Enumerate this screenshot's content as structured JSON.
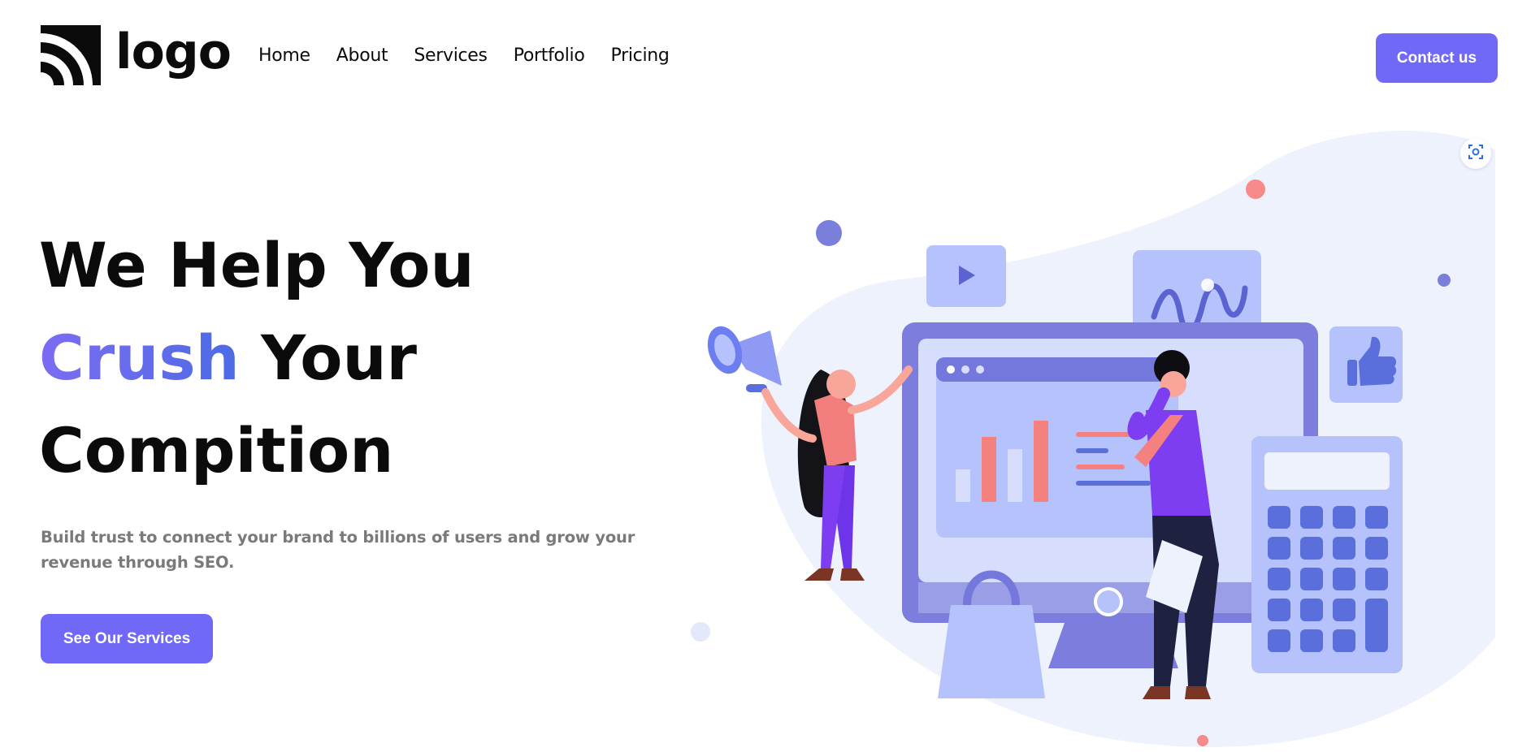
{
  "header": {
    "logo_text": "logo",
    "nav": [
      "Home",
      "About",
      "Services",
      "Portfolio",
      "Pricing"
    ],
    "contact_label": "Contact us"
  },
  "hero": {
    "title_line1": "We Help You",
    "title_accent": "Crush",
    "title_line2_rest": "Your",
    "title_line3": "Compition",
    "subtitle": "Build trust to connect your brand to billions of users and grow your revenue through SEO.",
    "cta_label": "See Our Services"
  },
  "icons": {
    "logo_mark": "wifi-arcs-logo-icon",
    "lens": "image-search-lens-icon",
    "play": "play-icon",
    "thumbs_up": "thumbs-up-icon",
    "megaphone": "megaphone-icon"
  },
  "colors": {
    "accent": "#7069f7",
    "accent_gradient_start": "#7c6cf2",
    "accent_gradient_end": "#4d6be6",
    "subtitle_gray": "#7a7a7a",
    "blob": "#eef2fd"
  }
}
